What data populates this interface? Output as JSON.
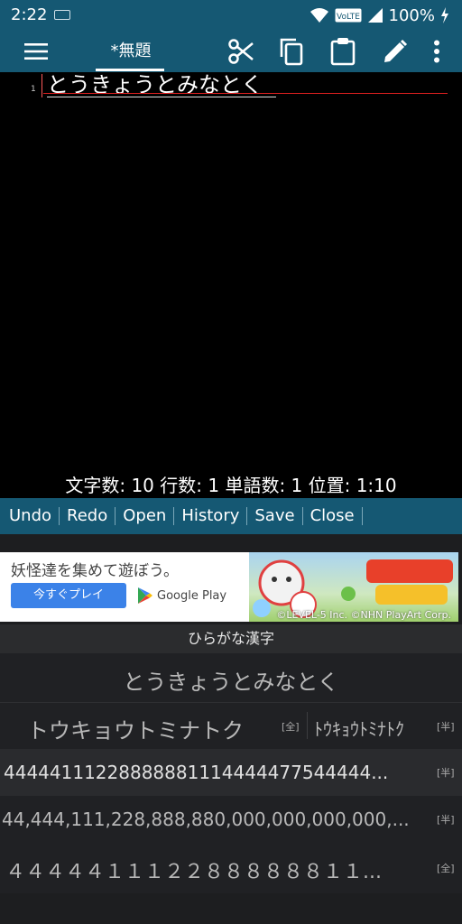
{
  "status": {
    "time": "2:22",
    "volte": "VoLTE",
    "battery": "100%"
  },
  "toolbar": {
    "tab_title": "*無題",
    "icons": [
      "menu-icon",
      "scissors-icon",
      "copy-icon",
      "clipboard-icon",
      "pencil-icon",
      "more-vert-icon"
    ]
  },
  "editor": {
    "line_number": "1",
    "line_text": "とうきょうとみなとく"
  },
  "stats": {
    "text": "文字数: 10  行数: 1  単語数: 1  位置: 1:10"
  },
  "actions": [
    "Undo",
    "Redo",
    "Open",
    "History",
    "Save",
    "Close"
  ],
  "ad": {
    "title": "妖怪達を集めて遊ぼう。",
    "cta": "今すぐプレイ",
    "store": "Google Play",
    "copyright": "©LEVEL-5 Inc. ©NHN PlayArt Corp."
  },
  "ime": {
    "mode": "ひらがな漢字",
    "candidates": [
      {
        "text": "とうきょうとみなとく"
      },
      {
        "text": "トウキョウトミナトク",
        "tag": "[全]",
        "text2": "ﾄｳｷｮｳﾄﾐﾅﾄｸ",
        "tag2": "[半]"
      },
      {
        "text": "44444111228888881114444477544444...",
        "tag": "[半]"
      },
      {
        "text": "44,444,111,228,888,880,000,000,000,000,...",
        "tag": "[半]"
      },
      {
        "text": "４４４４４１１１２２８８８８８８１１...",
        "tag": "[全]"
      }
    ]
  },
  "colors": {
    "primary": "#155873",
    "editor_bg": "#000000",
    "keyboard_bg": "#202124"
  }
}
